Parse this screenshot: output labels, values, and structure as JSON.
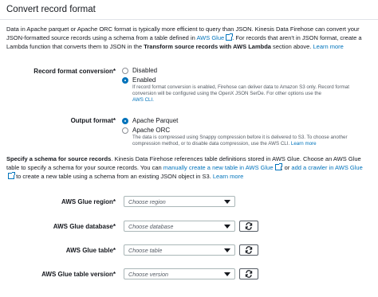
{
  "section_title": "Convert record format",
  "intro": {
    "t1": "Data in Apache parquet or Apache ORC format is typically more efficient to query than JSON. Kinesis Data Firehose can convert your JSON-formatted source records using a schema from a table defined in ",
    "glue_link": "AWS Glue",
    "t2": ". For records that aren't in JSON format, create a Lambda function that converts them to JSON in the ",
    "bold": "Transform source records with AWS Lambda",
    "t3": " section above. ",
    "learn_more": "Learn more"
  },
  "record_format": {
    "label": "Record format conversion*",
    "options": [
      {
        "label": "Disabled",
        "selected": false
      },
      {
        "label": "Enabled",
        "selected": true
      }
    ],
    "enabled_desc": "If record format conversion is enabled, Firehose can deliver data to Amazon S3 only. Record format conversion will be configured using the OpenX JSON SerDe. For other options use the",
    "aws_cli": "AWS CLI."
  },
  "output_format": {
    "label": "Output format*",
    "options": [
      {
        "label": "Apache Parquet",
        "selected": true
      },
      {
        "label": "Apache ORC",
        "selected": false
      }
    ],
    "orc_desc": "The data is compressed using Snappy compression before it is delivered to S3. To choose another compression method, or to disable data compression, use the AWS CLI.",
    "learn_more": "Learn more"
  },
  "schema": {
    "bold": "Specify a schema for source records",
    "t1": ". Kinesis Data Firehose references table definitions stored in AWS Glue. Choose an AWS Glue table to specify a schema for your source records. You can ",
    "link1": "manually create a new table in AWS Glue",
    "t2": "; or ",
    "link2": "add a crawler in AWS Glue",
    "t3": " to create a new table using a schema from an existing JSON object in S3. ",
    "learn_more": "Learn more"
  },
  "fields": {
    "region": {
      "label": "AWS Glue region*",
      "placeholder": "Choose region"
    },
    "database": {
      "label": "AWS Glue database*",
      "placeholder": "Choose database"
    },
    "table": {
      "label": "AWS Glue table*",
      "placeholder": "Choose table"
    },
    "version": {
      "label": "AWS Glue table version*",
      "placeholder": "Choose version"
    }
  },
  "icons": {
    "external": "external-link-icon",
    "refresh": "refresh-icon",
    "caret": "caret-down-icon"
  },
  "colors": {
    "link": "#0073bb",
    "radio_selected": "#0073bb",
    "border": "#aab7b8"
  }
}
